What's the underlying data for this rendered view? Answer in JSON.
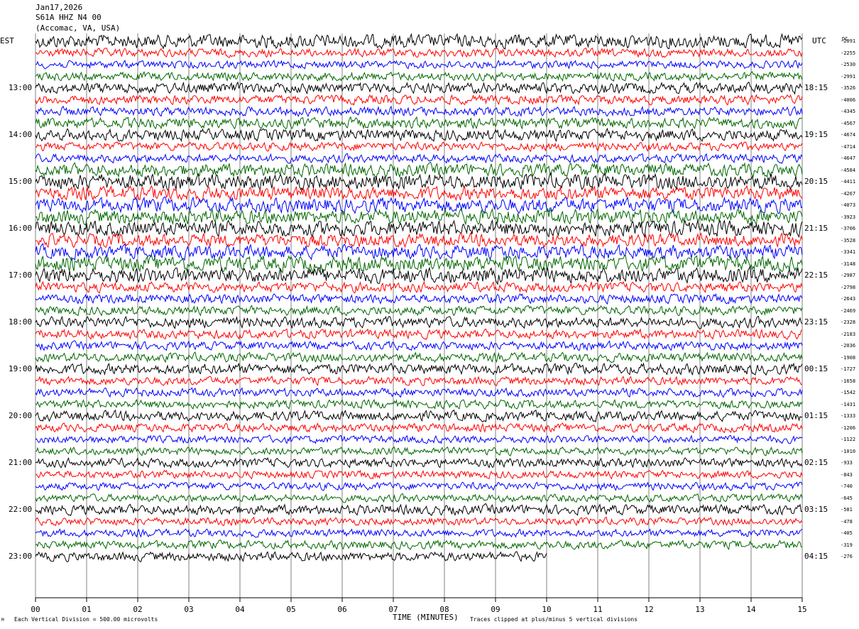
{
  "header": {
    "date": "Jan17,2026",
    "station": "S61A HHZ N4 00",
    "location": "(Accomac, VA, USA)"
  },
  "axes": {
    "left_zone_label": "EST",
    "right_zone_label": "UTC",
    "dc_label": "DC",
    "x_title": "TIME (MINUTES)",
    "x_ticks": [
      "00",
      "01",
      "02",
      "03",
      "04",
      "05",
      "06",
      "07",
      "08",
      "09",
      "10",
      "11",
      "12",
      "13",
      "14",
      "15"
    ]
  },
  "footer": {
    "mark": "M",
    "scale_note": "Each Vertical Division =  500.00 microvolts",
    "clip_note": "Traces clipped at plus/minus 5 vertical divisions"
  },
  "colors": {
    "trace_cycle": [
      "#000000",
      "#ff0000",
      "#0000ff",
      "#006600"
    ],
    "grid": "#808080"
  },
  "chart_data": {
    "type": "line",
    "description_type": "helicorder",
    "x_unit": "minutes",
    "xlim": [
      0,
      15
    ],
    "rows_per_hour": 4,
    "left_hour_labels": [
      "13:00",
      "14:00",
      "15:00",
      "16:00",
      "17:00",
      "18:00",
      "19:00",
      "20:00",
      "21:00",
      "22:00",
      "23:00"
    ],
    "right_hour_labels": [
      "18:15",
      "19:15",
      "20:15",
      "21:15",
      "22:15",
      "23:15",
      "00:15",
      "01:15",
      "02:15",
      "03:15",
      "04:15"
    ],
    "dc_offsets": [
      -2091,
      -2255,
      -2530,
      -2991,
      -3526,
      -4006,
      -4345,
      -4567,
      -4674,
      -4714,
      -4647,
      -4584,
      -4411,
      -4267,
      -4073,
      -3923,
      -3706,
      -3528,
      -3341,
      -3148,
      -2987,
      -2798,
      -2643,
      -2469,
      -2328,
      -2183,
      -2036,
      -1908,
      -1727,
      -1658,
      -1542,
      -1431,
      -1333,
      -1206,
      -1122,
      -1010,
      -933,
      -843,
      -740,
      -645,
      -581,
      -478,
      -405,
      -319,
      -276
    ],
    "last_row_end_minute": 10,
    "row_amplitudes": [
      0.9,
      0.55,
      0.5,
      0.55,
      0.7,
      0.6,
      0.6,
      0.7,
      0.75,
      0.55,
      0.55,
      0.85,
      1.0,
      0.9,
      0.95,
      0.95,
      1.0,
      0.85,
      0.9,
      1.0,
      1.0,
      0.65,
      0.6,
      0.6,
      0.7,
      0.6,
      0.55,
      0.6,
      0.7,
      0.55,
      0.55,
      0.55,
      0.65,
      0.55,
      0.5,
      0.5,
      0.6,
      0.5,
      0.5,
      0.5,
      0.65,
      0.5,
      0.5,
      0.55,
      0.6
    ]
  }
}
